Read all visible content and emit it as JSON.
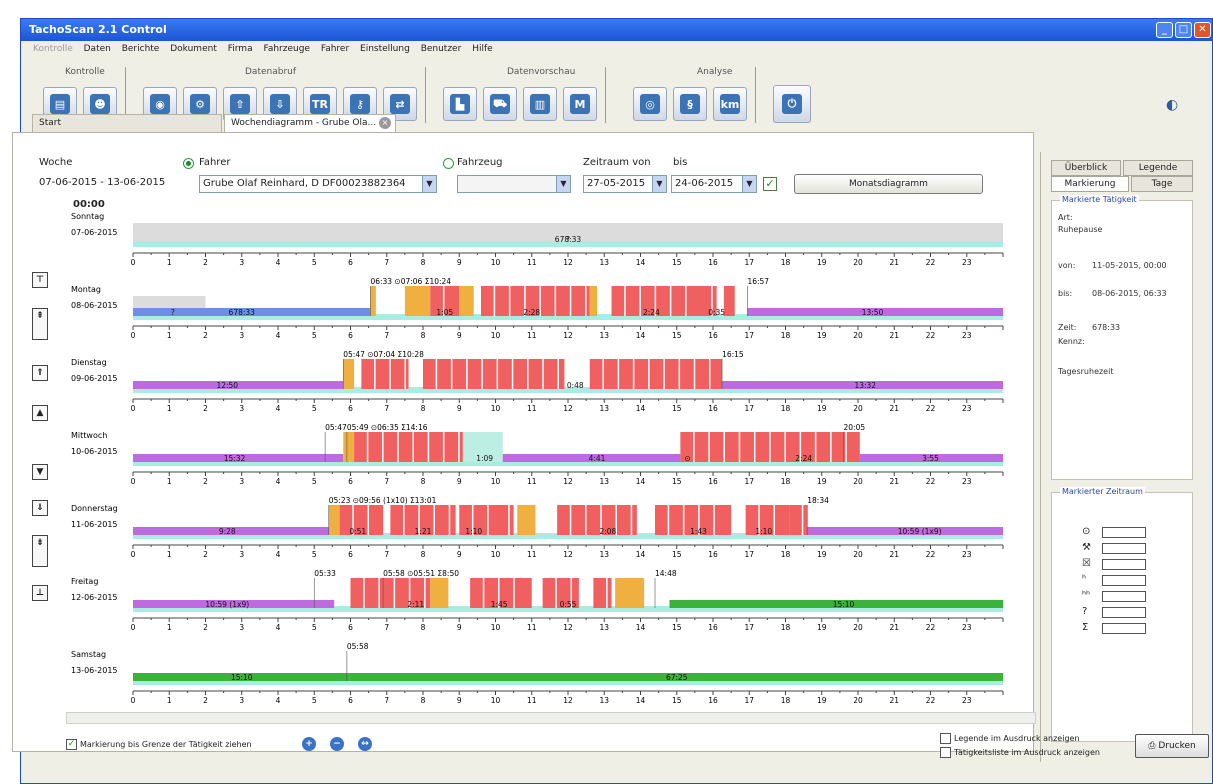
{
  "window": {
    "title": "TachoScan 2.1 Control"
  },
  "menu": [
    "Kontrolle",
    "Daten",
    "Berichte",
    "Dokument",
    "Firma",
    "Fahrzeuge",
    "Fahrer",
    "Einstellung",
    "Benutzer",
    "Hilfe"
  ],
  "toolbar": {
    "groups": [
      "Kontrolle",
      "Datenabruf",
      "Datenvorschau",
      "Analyse"
    ]
  },
  "tabs": {
    "start": "Start",
    "active": "Wochendiagramm - Grube Ola..."
  },
  "form": {
    "woche_label": "Woche",
    "woche_value": "07-06-2015 - 13-06-2015",
    "fahrer_label": "Fahrer",
    "fahrer_value": "Grube Olaf Reinhard, D DF00023882364",
    "fahrzeug_label": "Fahrzeug",
    "fahrzeug_value": "",
    "zeitraum_label": "Zeitraum von",
    "bis_label": "bis",
    "von_value": "27-05-2015",
    "bis_value": "24-06-2015",
    "monats_button": "Monatsdiagramm",
    "time_header": "00:00"
  },
  "days": [
    {
      "name": "Sonntag",
      "date": "07-06-2015",
      "annotations": [
        {
          "t": 12,
          "text": "?"
        },
        {
          "t": 12,
          "text": "678:33"
        }
      ],
      "bars": [
        {
          "s": 0,
          "e": 24,
          "kind": "unknown"
        }
      ]
    },
    {
      "name": "Montag",
      "date": "08-06-2015",
      "header": [
        {
          "t": 6.55,
          "text": "06:33 ⊙07:06 Σ10:24"
        },
        {
          "t": 16.95,
          "text": "16:57"
        }
      ],
      "annotations": [
        {
          "t": 1.1,
          "text": "?"
        },
        {
          "t": 3,
          "text": "678:33"
        },
        {
          "t": 8.6,
          "text": "1:05"
        },
        {
          "t": 11,
          "text": "2:28"
        },
        {
          "t": 14.3,
          "text": "2:24"
        },
        {
          "t": 16.1,
          "text": "0:35"
        },
        {
          "t": 20.4,
          "text": "13:50"
        }
      ],
      "bars": [
        {
          "s": 0,
          "e": 2,
          "kind": "unknown"
        },
        {
          "s": 0,
          "e": 6.55,
          "kind": "rest_blue"
        },
        {
          "s": 6.55,
          "e": 6.7,
          "kind": "work"
        },
        {
          "s": 7.5,
          "e": 8.2,
          "kind": "work"
        },
        {
          "s": 8.2,
          "e": 9.0,
          "kind": "drive"
        },
        {
          "s": 9.0,
          "e": 9.4,
          "kind": "work"
        },
        {
          "s": 9.6,
          "e": 12.6,
          "kind": "drive"
        },
        {
          "s": 12.6,
          "e": 12.8,
          "kind": "work"
        },
        {
          "s": 13.2,
          "e": 15.6,
          "kind": "drive"
        },
        {
          "s": 15.6,
          "e": 16.1,
          "kind": "drive"
        },
        {
          "s": 16.3,
          "e": 16.6,
          "kind": "drive"
        },
        {
          "s": 16.95,
          "e": 24,
          "kind": "rest"
        }
      ]
    },
    {
      "name": "Dienstag",
      "date": "09-06-2015",
      "header": [
        {
          "t": 5.8,
          "text": "05:47 ⊙07:04 Σ10:28"
        },
        {
          "t": 16.25,
          "text": "16:15"
        }
      ],
      "annotations": [
        {
          "t": 2.6,
          "text": "12:50"
        },
        {
          "t": 12.2,
          "text": "0:48"
        },
        {
          "t": 20.2,
          "text": "13:32"
        }
      ],
      "bars": [
        {
          "s": 0,
          "e": 5.8,
          "kind": "rest"
        },
        {
          "s": 5.8,
          "e": 6.1,
          "kind": "work"
        },
        {
          "s": 6.3,
          "e": 7.6,
          "kind": "drive"
        },
        {
          "s": 8.0,
          "e": 11.9,
          "kind": "drive"
        },
        {
          "s": 12.6,
          "e": 16.25,
          "kind": "drive"
        },
        {
          "s": 16.25,
          "e": 24,
          "kind": "rest"
        }
      ]
    },
    {
      "name": "Mittwoch",
      "date": "10-06-2015",
      "header": [
        {
          "t": 5.3,
          "text": "05:47"
        },
        {
          "t": 5.9,
          "text": "05:49 ⊙06:35 Σ14:16"
        },
        {
          "t": 19.6,
          "text": "20:05"
        }
      ],
      "annotations": [
        {
          "t": 2.8,
          "text": "15:32"
        },
        {
          "t": 9.7,
          "text": "1:09"
        },
        {
          "t": 12.8,
          "text": "4:41"
        },
        {
          "t": 15.3,
          "text": "⊙"
        },
        {
          "t": 18.5,
          "text": "2:24"
        },
        {
          "t": 22,
          "text": "3:55"
        }
      ],
      "bars": [
        {
          "s": 0,
          "e": 5.8,
          "kind": "rest"
        },
        {
          "s": 5.8,
          "e": 6.1,
          "kind": "work"
        },
        {
          "s": 6.1,
          "e": 9.1,
          "kind": "drive"
        },
        {
          "s": 9.1,
          "e": 10.2,
          "kind": "avail"
        },
        {
          "s": 10.2,
          "e": 15.1,
          "kind": "rest"
        },
        {
          "s": 15.1,
          "e": 20.05,
          "kind": "drive"
        },
        {
          "s": 20.05,
          "e": 24,
          "kind": "rest"
        }
      ]
    },
    {
      "name": "Donnerstag",
      "date": "11-06-2015",
      "header": [
        {
          "t": 5.4,
          "text": "05:23 ⊙09:56 (1x10) Σ13:01"
        },
        {
          "t": 18.6,
          "text": "18:34"
        }
      ],
      "annotations": [
        {
          "t": 2.6,
          "text": "9:28"
        },
        {
          "t": 6.2,
          "text": "0:51"
        },
        {
          "t": 8.0,
          "text": "1:21"
        },
        {
          "t": 9.4,
          "text": "1:10"
        },
        {
          "t": 13.1,
          "text": "2:08"
        },
        {
          "t": 15.6,
          "text": "1:43"
        },
        {
          "t": 17.4,
          "text": "1:10"
        },
        {
          "t": 21.7,
          "text": "10:59 (1x9)"
        }
      ],
      "bars": [
        {
          "s": 0,
          "e": 5.4,
          "kind": "rest"
        },
        {
          "s": 5.4,
          "e": 5.7,
          "kind": "work"
        },
        {
          "s": 5.7,
          "e": 6.9,
          "kind": "drive"
        },
        {
          "s": 7.1,
          "e": 8.9,
          "kind": "drive"
        },
        {
          "s": 9.0,
          "e": 10.0,
          "kind": "drive"
        },
        {
          "s": 10.0,
          "e": 10.5,
          "kind": "drive"
        },
        {
          "s": 10.6,
          "e": 11.1,
          "kind": "work"
        },
        {
          "s": 11.7,
          "e": 13.9,
          "kind": "drive"
        },
        {
          "s": 14.4,
          "e": 16.5,
          "kind": "drive"
        },
        {
          "s": 16.9,
          "e": 18.1,
          "kind": "drive"
        },
        {
          "s": 18.1,
          "e": 18.6,
          "kind": "drive"
        },
        {
          "s": 18.6,
          "e": 24,
          "kind": "rest"
        }
      ]
    },
    {
      "name": "Freitag",
      "date": "12-06-2015",
      "header": [
        {
          "t": 5.0,
          "text": "05:33"
        },
        {
          "t": 6.9,
          "text": "05:58 ⊙05:51 Σ8:50"
        },
        {
          "t": 14.4,
          "text": "14:48"
        }
      ],
      "annotations": [
        {
          "t": 2.6,
          "text": "10:59 (1x9)"
        },
        {
          "t": 7.8,
          "text": "2:11"
        },
        {
          "t": 10.1,
          "text": "1:45"
        },
        {
          "t": 12.0,
          "text": "0:55"
        },
        {
          "t": 19.6,
          "text": "15:10"
        }
      ],
      "bars": [
        {
          "s": 0,
          "e": 5.55,
          "kind": "rest"
        },
        {
          "s": 6.0,
          "e": 8.2,
          "kind": "drive"
        },
        {
          "s": 8.2,
          "e": 8.7,
          "kind": "work"
        },
        {
          "s": 9.3,
          "e": 11.0,
          "kind": "drive"
        },
        {
          "s": 11.3,
          "e": 12.3,
          "kind": "drive"
        },
        {
          "s": 12.7,
          "e": 13.2,
          "kind": "drive"
        },
        {
          "s": 13.3,
          "e": 14.1,
          "kind": "work"
        },
        {
          "s": 14.8,
          "e": 24,
          "kind": "rest_green"
        }
      ]
    },
    {
      "name": "Samstag",
      "date": "13-06-2015",
      "header": [
        {
          "t": 5.9,
          "text": "05:58"
        }
      ],
      "annotations": [
        {
          "t": 3.0,
          "text": "15:10"
        },
        {
          "t": 15.0,
          "text": "67:25"
        }
      ],
      "bars": [
        {
          "s": 0,
          "e": 5.97,
          "kind": "rest_green_light"
        },
        {
          "s": 5.97,
          "e": 24,
          "kind": "rest_green"
        }
      ]
    }
  ],
  "hours": [
    0,
    1,
    2,
    3,
    4,
    5,
    6,
    7,
    8,
    9,
    10,
    11,
    12,
    13,
    14,
    15,
    16,
    17,
    18,
    19,
    20,
    21,
    22,
    23
  ],
  "colors": {
    "drive": "#f06060",
    "work": "#f0b040",
    "rest": "#c06ae0",
    "rest_blue": "#6f8ee6",
    "rest_green": "#3bb33b",
    "unknown": "#dcdcdc",
    "avail": "#bdeee4",
    "line": "#a8ece2"
  },
  "right_panel": {
    "tabs": [
      "Überblick",
      "Legende",
      "Markierung",
      "Tage"
    ],
    "marked_activity_caption": "Markierte Tätigkeit",
    "art_label": "Art:",
    "art_value": "Ruhepause",
    "von_label": "von:",
    "von_value": "11-05-2015, 00:00",
    "bis_label": "bis:",
    "bis_value": "08-06-2015, 06:33",
    "zeit_label": "Zeit:",
    "zeit_value": "678:33",
    "kennz_label": "Kennz:",
    "note": "Tagesruhezeit",
    "marked_period_caption": "Markierter Zeitraum",
    "legend_symbols": [
      "⊙",
      "⚒",
      "☒",
      "ʰ",
      "ʰʰ",
      "?",
      "Σ"
    ]
  },
  "bottom": {
    "marking_check": "Markierung bis Grenze der Tätigkeit ziehen",
    "legend_print": "Legende im Ausdruck anzeigen",
    "activity_print": "Tätigkeitsliste im Ausdruck anzeigen",
    "print_button": "Drucken"
  }
}
